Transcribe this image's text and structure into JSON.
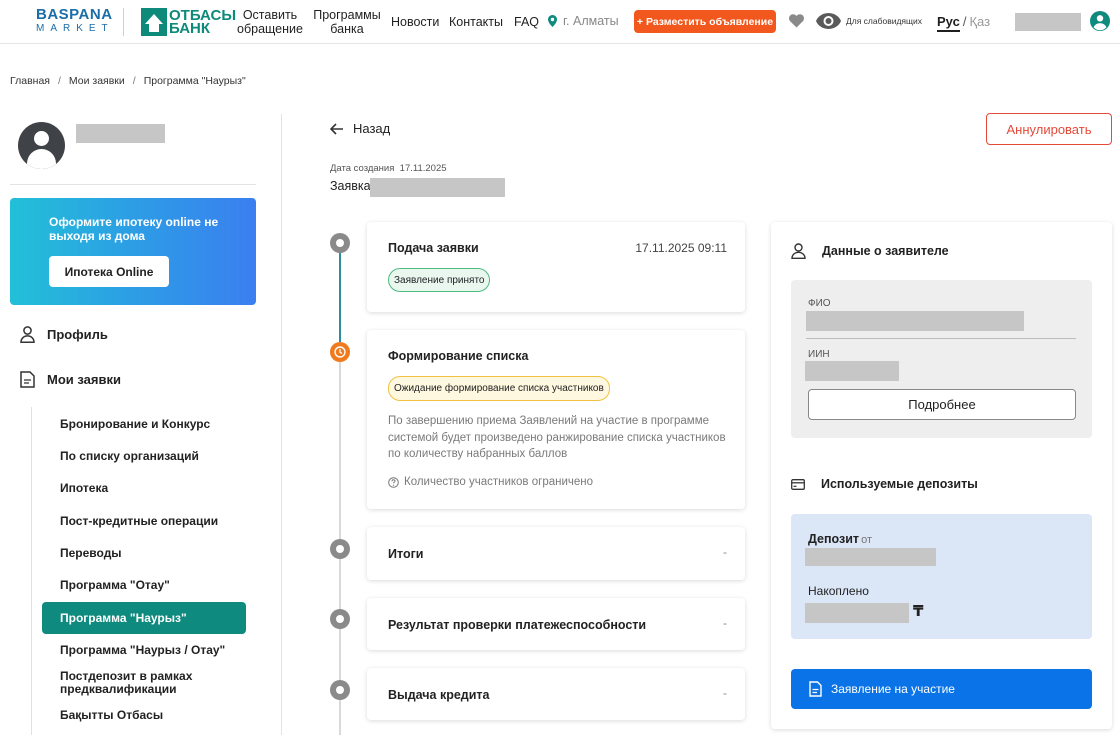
{
  "header": {
    "logo_baspana_top": "BASPANA",
    "logo_baspana_bottom": "MARKET",
    "logo_otbasy_top": "ОТБАСЫ",
    "logo_otbasy_bottom": "БАНК",
    "nav": {
      "leave_request": "Оставить обращение",
      "bank_programs": "Программы банка",
      "news": "Новости",
      "contacts": "Контакты",
      "faq": "FAQ"
    },
    "city": "г. Алматы",
    "post_ad": "+ Разместить объявление",
    "accessibility": "Для слабовидящих",
    "lang_ru": "Рус",
    "lang_sep": "/",
    "lang_kz": "Қаз",
    "accent_color": "#f2581e"
  },
  "breadcrumb": {
    "home": "Главная",
    "sep": "/",
    "my_requests": "Мои заявки",
    "current": "Программа \"Наурыз\""
  },
  "sidebar": {
    "promo_text": "Оформите ипотеку online не выходя из дома",
    "promo_button": "Ипотека Online",
    "profile": "Профиль",
    "my_requests": "Мои заявки",
    "items": [
      "Бронирование и Конкурс",
      "По списку организаций",
      "Ипотека",
      "Пост-кредитные операции",
      "Переводы",
      "Программа \"Отау\"",
      "Программа \"Наурыз\"",
      "Программа \"Наурыз / Отау\"",
      "Постдепозит в рамках предквалификации",
      "Бақытты Отбасы"
    ],
    "active_index": 6,
    "active_color": "#0f8a7e"
  },
  "content": {
    "back": "Назад",
    "cancel": "Аннулировать",
    "created_label": "Дата создания",
    "created_date": "17.11.2025",
    "request_label": "Заявка"
  },
  "timeline": [
    {
      "title": "Подача заявки",
      "date": "17.11.2025 09:11",
      "badge": "Заявление принято",
      "state": "done"
    },
    {
      "title": "Формирование списка",
      "badge": "Ожидание формирование списка участников",
      "description": "По завершению приема Заявлений на участие в программе системой будет произведено ранжирование списка участников по количеству набранных баллов",
      "note": "Количество участников ограничено",
      "state": "current"
    },
    {
      "title": "Итоги",
      "dash": "-",
      "state": "pending"
    },
    {
      "title": "Результат проверки платежеспособности",
      "dash": "-",
      "state": "pending"
    },
    {
      "title": "Выдача кредита",
      "dash": "-",
      "state": "pending"
    }
  ],
  "applicant": {
    "heading": "Данные о заявителе",
    "fio_label": "ФИО",
    "iin_label": "ИИН",
    "more_button": "Подробнее"
  },
  "deposits": {
    "heading": "Используемые депозиты",
    "deposit_label": "Депозит",
    "deposit_from": "от",
    "accumulated_label": "Накоплено",
    "currency": "₸",
    "apply_button": "Заявление на участие",
    "button_color": "#0a73e8"
  }
}
